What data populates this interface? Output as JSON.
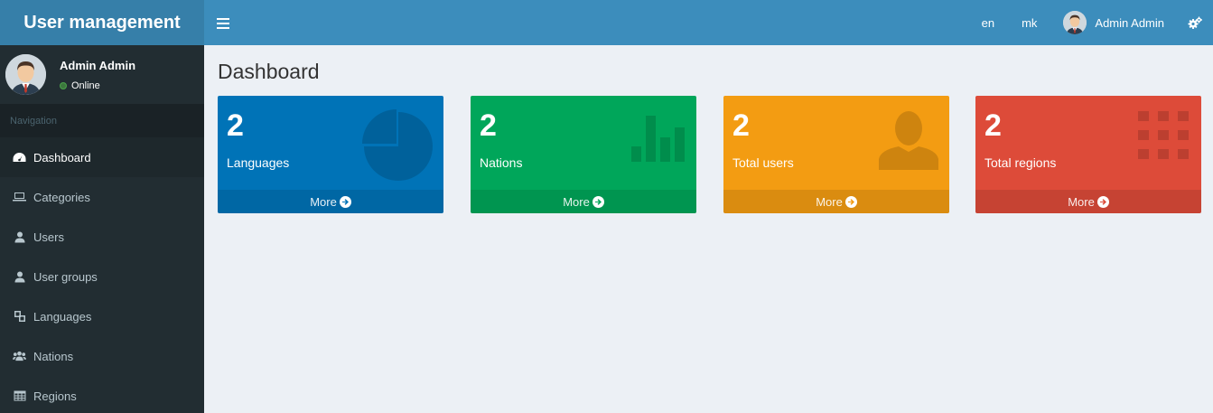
{
  "brand": "User management",
  "user": {
    "name": "Admin Admin",
    "status": "Online"
  },
  "sidebar": {
    "header": "Navigation",
    "items": [
      {
        "label": "Dashboard",
        "icon": "dashboard-icon",
        "active": true
      },
      {
        "label": "Categories",
        "icon": "laptop-icon"
      },
      {
        "label": "Users",
        "icon": "user-icon"
      },
      {
        "label": "User groups",
        "icon": "user-icon"
      },
      {
        "label": "Languages",
        "icon": "language-icon"
      },
      {
        "label": "Nations",
        "icon": "users-icon"
      },
      {
        "label": "Regions",
        "icon": "table-icon"
      }
    ]
  },
  "topbar": {
    "lang_en": "en",
    "lang_mk": "mk",
    "user_name": "Admin Admin"
  },
  "page": {
    "title": "Dashboard"
  },
  "boxes": [
    {
      "count": "2",
      "label": "Languages",
      "more": "More",
      "color": "#0073b7",
      "icon": "pie-chart-icon"
    },
    {
      "count": "2",
      "label": "Nations",
      "more": "More",
      "color": "#00a65a",
      "icon": "bar-chart-icon"
    },
    {
      "count": "2",
      "label": "Total users",
      "more": "More",
      "color": "#f39c12",
      "icon": "person-icon"
    },
    {
      "count": "2",
      "label": "Total regions",
      "more": "More",
      "color": "#dd4b39",
      "icon": "grid-icon"
    }
  ]
}
